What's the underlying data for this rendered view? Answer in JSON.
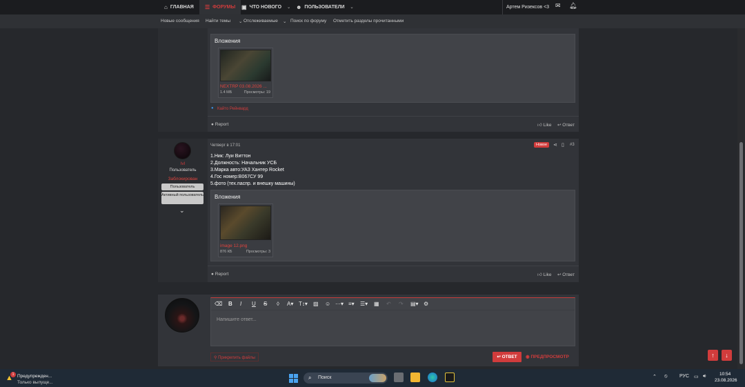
{
  "topnav": {
    "items": [
      {
        "label": "ГЛАВНАЯ",
        "icon": "home-icon"
      },
      {
        "label": "ФОРУМЫ",
        "icon": "forum-icon"
      },
      {
        "label": "ЧТО НОВОГО",
        "icon": "chat-icon"
      },
      {
        "label": "ПОЛЬЗОВАТЕЛИ",
        "icon": "users-icon"
      }
    ],
    "user": "Артем Ризексов <3"
  },
  "subnav": {
    "items": [
      "Новые сообщения",
      "Найти темы",
      "Отслеживаемые",
      "Поиск по форуму",
      "Отметить разделы прочитанными"
    ]
  },
  "post1": {
    "attachments_title": "Вложения",
    "attachment": {
      "name": "NEXTRP 03.08.2026 ...",
      "size": "1.4 МБ",
      "views": "Просмотры: 19"
    },
    "reaction": "Кайто Рейнвард",
    "report": "Report",
    "like": "Like",
    "reply": "Ответ"
  },
  "post2": {
    "user": {
      "name": "lvl",
      "title": "Пользователь",
      "blurred": "Заблокирован",
      "banners": [
        "Пользователь",
        "Активный пользователь"
      ]
    },
    "date": "Четверг в 17:01",
    "badge": "Новое",
    "number": "#3",
    "lines": [
      "1.Ник: Луи Виттон",
      "2.Должность: Начальник УСБ",
      "3.Марка авто:УАЗ Хантер Rocket",
      "4.Гос номер:В067СУ 99",
      "5.фото (тех.паспр. и внешку машины)"
    ],
    "attachments_title": "Вложения",
    "attachment": {
      "name": "image 12.png",
      "size": "876 КБ",
      "views": "Просмотры: 3"
    },
    "report": "Report",
    "like": "Like",
    "reply": "Ответ"
  },
  "reply_box": {
    "placeholder": "Напишите ответ...",
    "attach_label": "Прикрепить файлы",
    "reply_button": "ОТВЕТ",
    "preview_button": "ПРЕДПРОСМОТР"
  },
  "taskbar": {
    "notification": {
      "count": "1",
      "line1": "Предупрежден...",
      "line2": "Только выпуще..."
    },
    "search_label": "Поиск",
    "lang": "РУС",
    "time": "10:54",
    "date": "23.08.2026"
  },
  "colors": {
    "accent": "#d13c3c",
    "background": "#26282c",
    "panel": "#323439"
  }
}
